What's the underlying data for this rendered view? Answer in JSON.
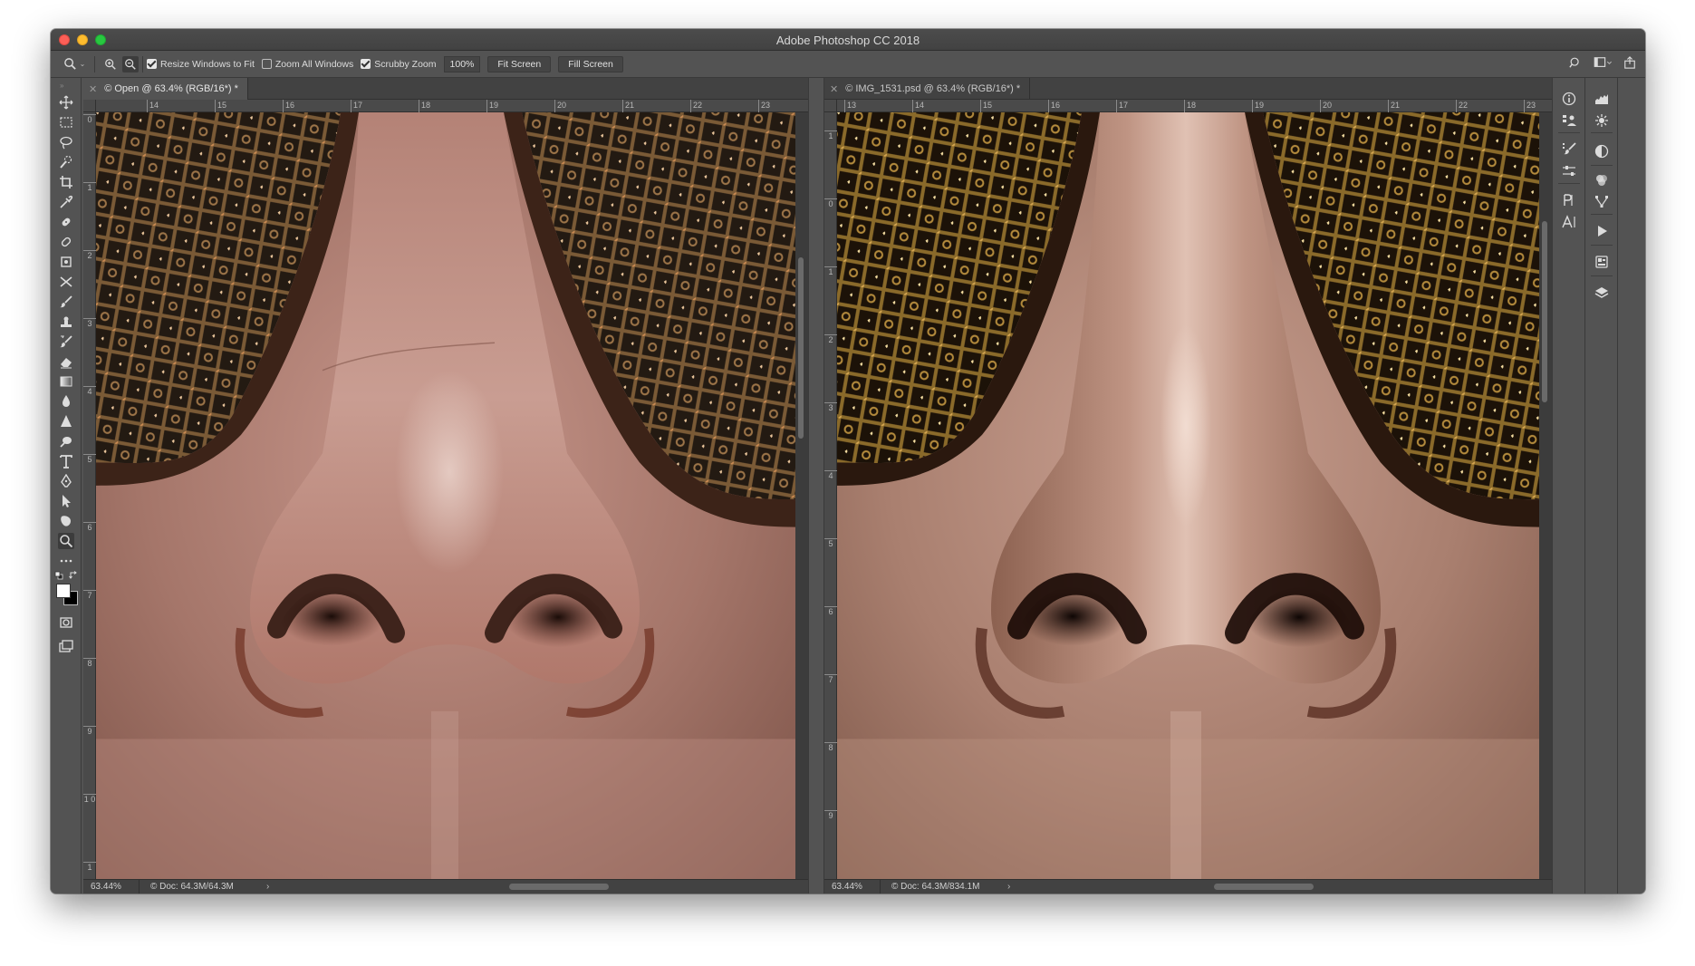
{
  "window": {
    "title": "Adobe Photoshop CC 2018"
  },
  "options_bar": {
    "resize_windows_label": "Resize Windows to Fit",
    "resize_windows_checked": true,
    "zoom_all_label": "Zoom All Windows",
    "zoom_all_checked": false,
    "scrubby_zoom_label": "Scrubby Zoom",
    "scrubby_zoom_checked": true,
    "zoom_value": "100%",
    "fit_screen_label": "Fit Screen",
    "fill_screen_label": "Fill Screen"
  },
  "documents": [
    {
      "tab_label": "© Open @ 63.4% (RGB/16*) *",
      "active": true,
      "ruler_h": [
        "14",
        "15",
        "16",
        "17",
        "18",
        "19",
        "20",
        "21",
        "22",
        "23"
      ],
      "ruler_v": [
        "0",
        "1",
        "2",
        "3",
        "4",
        "5",
        "6",
        "7",
        "8",
        "9",
        "1 0",
        "1"
      ],
      "zoom": "63.44%",
      "doc_size": "© Doc: 64.3M/64.3M",
      "arrow": "›"
    },
    {
      "tab_label": "© IMG_1531.psd @ 63.4% (RGB/16*) *",
      "active": false,
      "ruler_h": [
        "13",
        "14",
        "15",
        "16",
        "17",
        "18",
        "19",
        "20",
        "21",
        "22",
        "23"
      ],
      "ruler_v": [
        "1",
        "0",
        "1",
        "2",
        "3",
        "4",
        "5",
        "6",
        "7",
        "8",
        "9"
      ],
      "zoom": "63.44%",
      "doc_size": "© Doc: 64.3M/834.1M",
      "arrow": "›"
    }
  ],
  "colors": {
    "app_bg": "#535353",
    "foreground_swatch": "#ffffff",
    "background_swatch": "#000000"
  }
}
